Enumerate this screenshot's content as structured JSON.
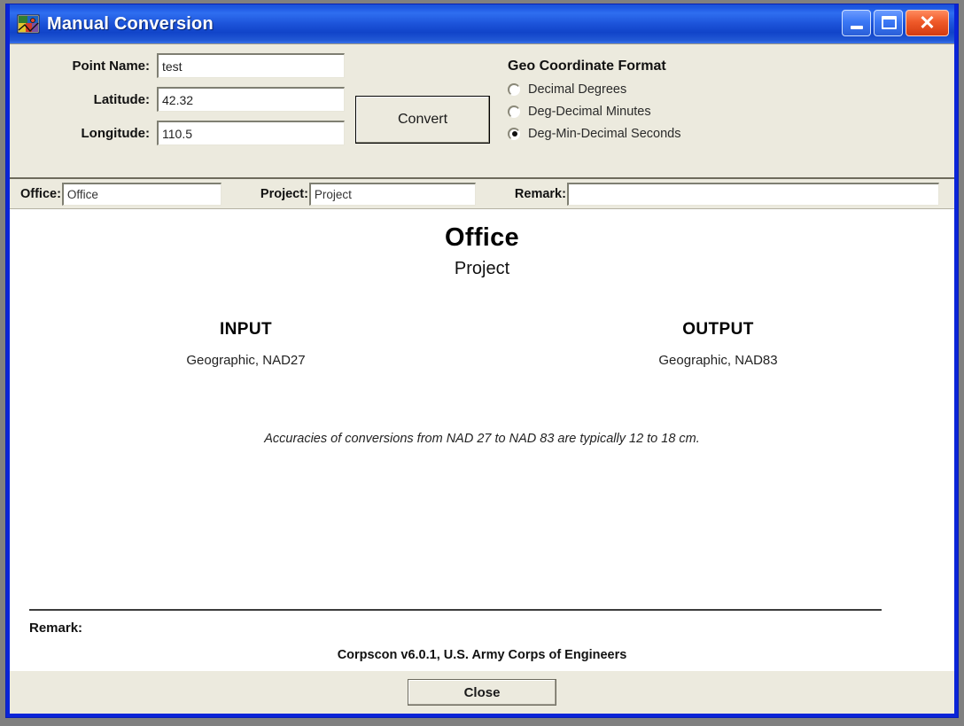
{
  "window": {
    "title": "Manual Conversion",
    "icon": "corpscon-app-icon",
    "minimize_label": "",
    "maximize_label": "",
    "close_label": "✕"
  },
  "form": {
    "fields": [
      {
        "label": "Point Name:",
        "value": "test",
        "placeholder": ""
      },
      {
        "label": "Latitude:",
        "value": "42.32",
        "placeholder": ""
      },
      {
        "label": "Longitude:",
        "value": "110.5",
        "placeholder": ""
      }
    ],
    "convert_button": "Convert"
  },
  "geo_format": {
    "title": "Geo Coordinate Format",
    "options": [
      {
        "label": "Decimal Degrees",
        "selected": false
      },
      {
        "label": "Deg-Decimal Minutes",
        "selected": false
      },
      {
        "label": "Deg-Min-Decimal Seconds",
        "selected": true
      }
    ]
  },
  "meta_bar": {
    "office_label": "Office:",
    "office_value": "Office",
    "project_label": "Project:",
    "project_value": "Project",
    "remark_label": "Remark:",
    "remark_value": ""
  },
  "report": {
    "office_heading": "Office",
    "project_heading": "Project",
    "input_title": "INPUT",
    "input_datum": "Geographic, NAD27",
    "output_title": "OUTPUT",
    "output_datum": "Geographic, NAD83",
    "note": "Accuracies of conversions from NAD 27 to NAD 83 are typically 12 to 18 cm.",
    "remark_label": "Remark:",
    "credit": "Corpscon v6.0.1, U.S. Army Corps of Engineers"
  },
  "footer": {
    "close_button": "Close"
  },
  "colors": {
    "titlebar_blue": "#1c53d9",
    "window_border": "#0a24d8",
    "panel_beige": "#eceade",
    "report_white": "#ffffff",
    "close_button_red": "#ef5a29",
    "desktop_gray": "#808080"
  }
}
